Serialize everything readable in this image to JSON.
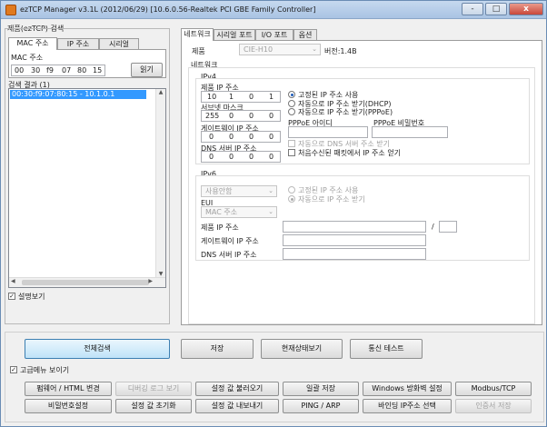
{
  "window": {
    "title": "ezTCP Manager v3.1L (2012/06/29) [10.6.0.56-Realtek PCI GBE Family Controller]",
    "minimize": "-",
    "maximize": "□",
    "close": "x"
  },
  "search_panel": {
    "group_title": "제품(ezTCP) 검색",
    "tabs": [
      "MAC 주소",
      "IP 주소",
      "시리얼"
    ],
    "mac_label": "MAC 주소",
    "mac_octets": [
      "00",
      "30",
      "f9",
      "07",
      "80",
      "15"
    ],
    "read_button": "읽기",
    "results_label": "검색 결과 (1)",
    "results": [
      "00:30:f9:07:80:15 - 10.1.0.1"
    ],
    "show_comment_label": "설명보기",
    "show_comment_checked": true
  },
  "main_tabs": [
    "네트워크",
    "시리얼 포트",
    "I/O 포트",
    "옵션"
  ],
  "product": {
    "label": "제품",
    "value": "CIE-H10",
    "version_label": "버전:1.4B"
  },
  "network": {
    "title": "네트워크",
    "ipv4_title": "IPv4",
    "ip_label": "제품 IP 주소",
    "ip_octets": [
      "10",
      "1",
      "0",
      "1"
    ],
    "subnet_label": "서브넷 마스크",
    "subnet_octets": [
      "255",
      "0",
      "0",
      "0"
    ],
    "gateway_label": "게이트웨이 IP 주소",
    "gateway_octets": [
      "0",
      "0",
      "0",
      "0"
    ],
    "dns_label": "DNS 서버 IP 주소",
    "dns_octets": [
      "0",
      "0",
      "0",
      "0"
    ],
    "radio_static": "고정된 IP 주소 사용",
    "radio_dhcp": "자동으로 IP 주소 받기(DHCP)",
    "radio_pppoe": "자동으로 IP 주소 받기(PPPoE)",
    "pppoe_id_label": "PPPoE 아이디",
    "pppoe_pw_label": "PPPoE 비밀번호",
    "auto_dns_label": "자동으로 DNS 서버 주소 받기",
    "first_packet_label": "처음수신된 패킷에서 IP 주소 얻기",
    "ipv6_title": "IPv6",
    "ipv6_mode": "사용안함",
    "eui_label": "EUI",
    "eui_value": "MAC 주소",
    "v6_radio_static": "고정된 IP 주소 사용",
    "v6_radio_auto": "자동으로 IP 주소 받기",
    "v6_ip_label": "제품 IP 주소",
    "v6_gateway_label": "게이트웨이 IP 주소",
    "v6_dns_label": "DNS 서버 IP 주소",
    "prefix_sep": "/"
  },
  "actions": {
    "search_all": "전체검색",
    "save": "저장",
    "view_status": "현재상태보기",
    "comm_test": "통신 테스트",
    "advanced_menu": "고급메뉴 보이기",
    "advanced_checked": true
  },
  "advanced": {
    "row1": [
      "펌웨어 / HTML 변경",
      "디버깅 로그 보기",
      "설정 값 불러오기",
      "일괄 저장",
      "Windows 방화벽 설정",
      "Modbus/TCP"
    ],
    "row2": [
      "비밀번호설정",
      "설정 값 초기화",
      "설정 값 내보내기",
      "PING / ARP",
      "바인딩 IP주소 선택",
      "인증서 저장"
    ]
  }
}
